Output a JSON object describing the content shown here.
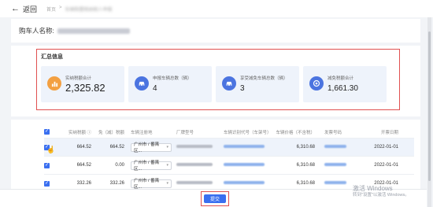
{
  "topbar": {
    "back_label": "返回",
    "breadcrumb_home": "首页",
    "breadcrumb_sep": ">",
    "breadcrumb_current": "车辆购置税纳税人申报"
  },
  "buyer": {
    "label": "购车人名称:"
  },
  "summary": {
    "title": "汇总信息",
    "cards": [
      {
        "label": "实纳税额合计",
        "value": "2,325.82",
        "icon": "bar-chart-icon",
        "color": "#f3a042"
      },
      {
        "label": "申报车辆总数（辆）",
        "value": "4",
        "icon": "car-icon",
        "color": "#4b74e0"
      },
      {
        "label": "享受减免车辆总数（辆）",
        "value": "3",
        "icon": "car-icon",
        "color": "#4b74e0"
      },
      {
        "label": "减免税额合计",
        "value": "1,661.30",
        "icon": "coin-icon",
        "color": "#4b74e0"
      }
    ]
  },
  "table": {
    "headers": [
      "实纳税额",
      "免（减）税额",
      "车辆注册地",
      "厂牌型号",
      "车辆识别代号（车架号）",
      "车辆价格（不含税）",
      "发票号码",
      "开票日期"
    ],
    "header_info_icon": "ⓘ",
    "rows": [
      {
        "paid": "664.52",
        "exempt": "664.52",
        "region": "广州市 / 番禺区...",
        "price": "6,310.68",
        "date": "2022-01-01"
      },
      {
        "paid": "664.52",
        "exempt": "0.00",
        "region": "广州市 / 番禺区...",
        "price": "6,310.68",
        "date": "2022-01-01"
      },
      {
        "paid": "332.26",
        "exempt": "332.26",
        "region": "广州市 / 番禺区...",
        "price": "6,310.68",
        "date": "2022-01-01"
      }
    ]
  },
  "footer": {
    "submit_label": "提交"
  },
  "watermark": {
    "line1": "激活 Windows",
    "line2": "转到\"设置\"以激活 Windows。"
  },
  "colors": {
    "accent": "#3a6ff0",
    "highlight_box": "#e05050",
    "card_bg": "#eef3fb"
  }
}
